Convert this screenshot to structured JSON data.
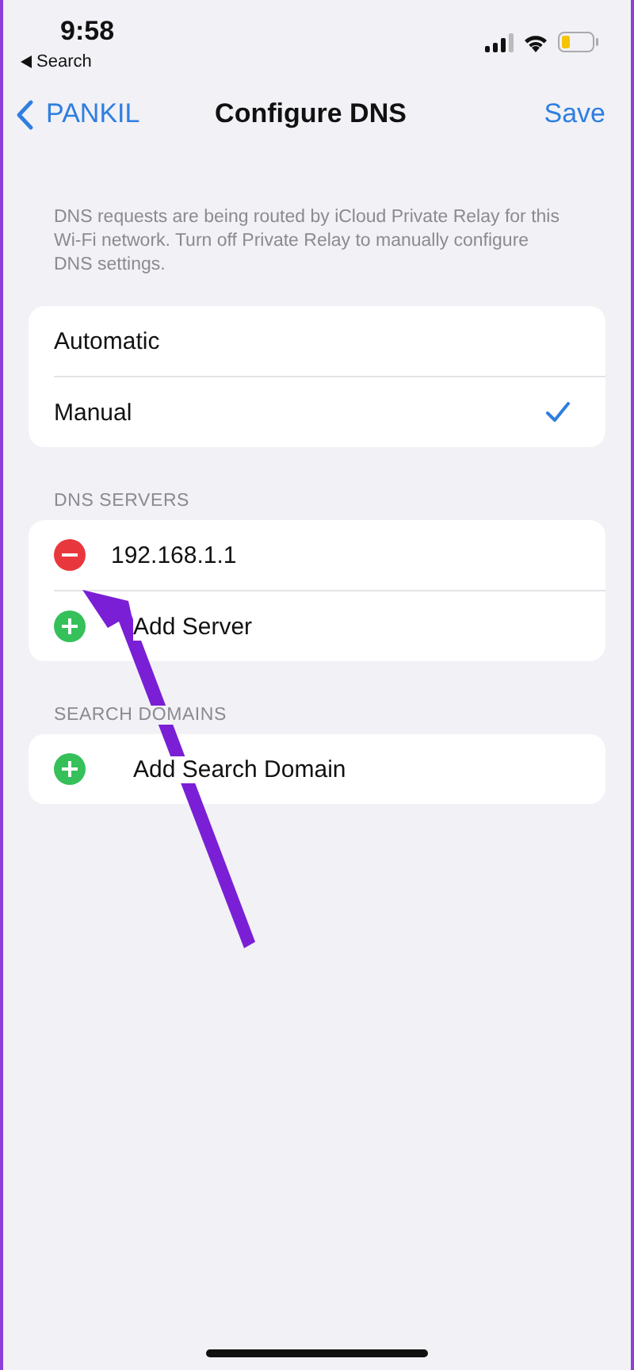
{
  "status_bar": {
    "time": "9:58",
    "back_label": "Search"
  },
  "nav": {
    "back": "PANKIL",
    "title": "Configure DNS",
    "action": "Save"
  },
  "note": "DNS requests are being routed by iCloud Private Relay for this Wi-Fi network. Turn off Private Relay to manually configure DNS settings.",
  "mode_options": [
    {
      "label": "Automatic",
      "selected": false
    },
    {
      "label": "Manual",
      "selected": true
    }
  ],
  "sections": [
    {
      "header": "DNS SERVERS",
      "rows": [
        {
          "kind": "remove",
          "label": "192.168.1.1"
        },
        {
          "kind": "add",
          "label": "Add Server"
        }
      ]
    },
    {
      "header": "SEARCH DOMAINS",
      "rows": [
        {
          "kind": "add",
          "label": "Add Search Domain"
        }
      ]
    }
  ],
  "annotation": {
    "kind": "arrow"
  }
}
